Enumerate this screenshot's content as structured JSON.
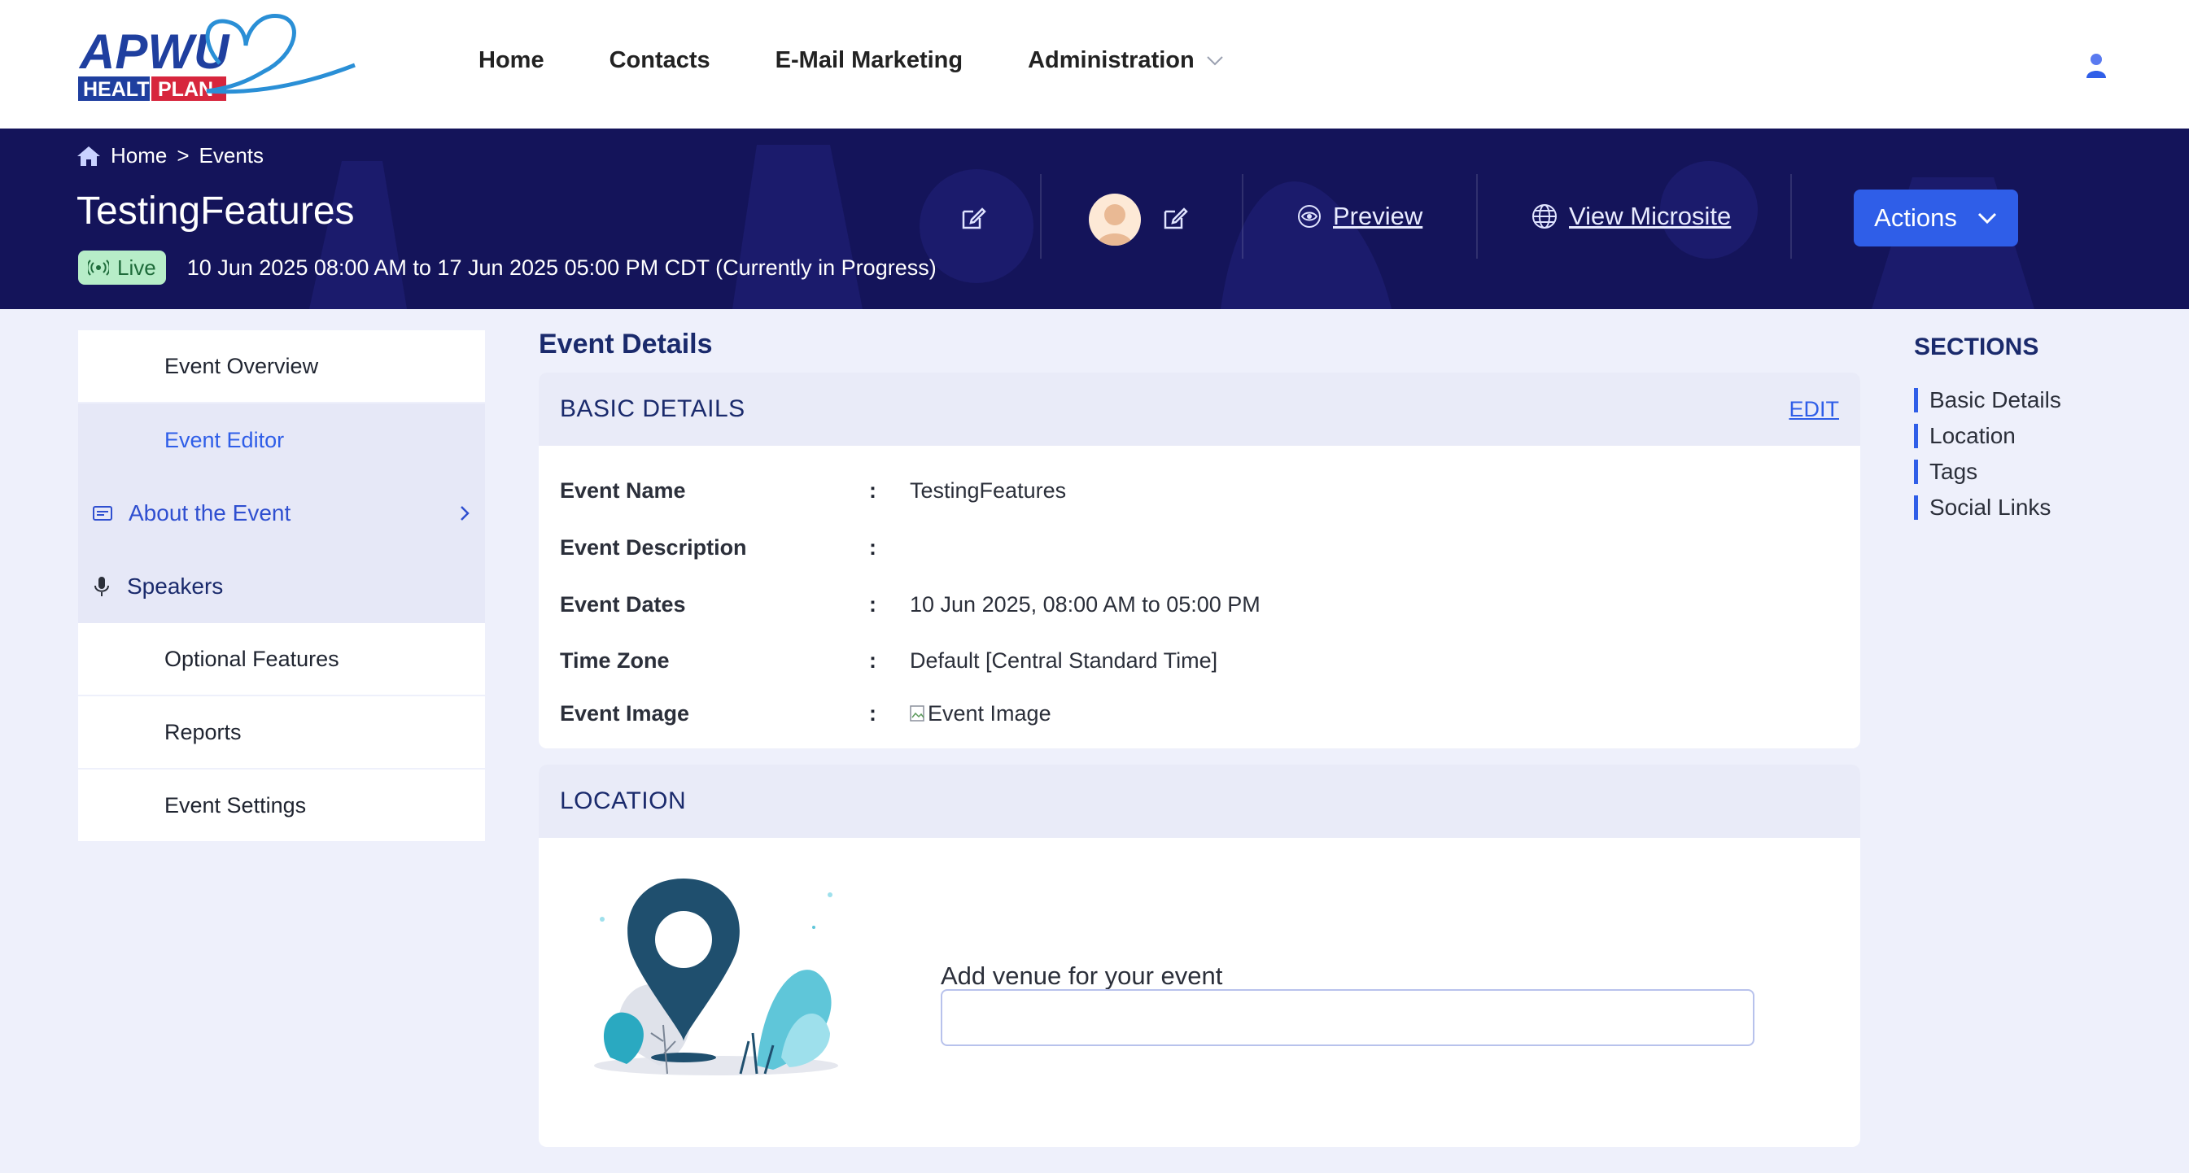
{
  "brand": {
    "logo_alt": "APWU HEALTH PLAN"
  },
  "nav": {
    "items": [
      {
        "label": "Home"
      },
      {
        "label": "Contacts"
      },
      {
        "label": "E-Mail Marketing"
      },
      {
        "label": "Administration"
      }
    ]
  },
  "header": {
    "breadcrumb": {
      "home": "Home",
      "separator": ">",
      "current": "Events"
    },
    "title": "TestingFeatures",
    "status": "Live",
    "date_range": "10 Jun 2025 08:00 AM to 17 Jun 2025 05:00 PM CDT  (Currently in Progress)",
    "preview_label": "Preview",
    "microsite_label": "View Microsite",
    "actions_label": "Actions"
  },
  "sidebar": {
    "items": [
      {
        "label": "Event Overview"
      },
      {
        "label": "Event Editor"
      },
      {
        "label": "About the Event"
      },
      {
        "label": "Speakers"
      },
      {
        "label": "Optional Features"
      },
      {
        "label": "Reports"
      },
      {
        "label": "Event Settings"
      }
    ]
  },
  "main": {
    "title": "Event Details",
    "basic": {
      "heading": "BASIC DETAILS",
      "edit_label": "EDIT",
      "rows": [
        {
          "key": "Event Name",
          "value": "TestingFeatures"
        },
        {
          "key": "Event Description",
          "value": ""
        },
        {
          "key": "Event Dates",
          "value": "10 Jun 2025, 08:00 AM to 05:00 PM"
        },
        {
          "key": "Time Zone",
          "value": "Default [Central Standard Time]"
        },
        {
          "key": "Event Image",
          "value": "Event Image"
        }
      ],
      "colon": ":"
    },
    "location": {
      "heading": "LOCATION",
      "venue_label": "Add venue for your event",
      "venue_value": ""
    }
  },
  "sections": {
    "title": "SECTIONS",
    "items": [
      {
        "label": "Basic Details"
      },
      {
        "label": "Location"
      },
      {
        "label": "Tags"
      },
      {
        "label": "Social Links"
      }
    ]
  },
  "colors": {
    "header_bg": "#14145a",
    "accent": "#2f5ee8",
    "live_bg": "#b7edc8",
    "page_bg": "#eef0fb"
  }
}
